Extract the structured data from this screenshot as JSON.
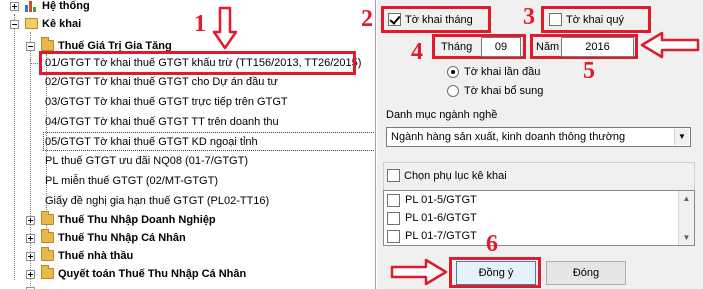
{
  "tree": {
    "items": [
      {
        "label": "Hệ thống",
        "bold": true
      },
      {
        "label": "Kê khai",
        "bold": true
      },
      {
        "label": "Thuế Giá Trị Gia Tăng",
        "bold": true
      },
      {
        "label": "01/GTGT Tờ khai thuế GTGT khấu trừ (TT156/2013, TT26/2015)",
        "bold": false
      },
      {
        "label": "02/GTGT Tờ khai thuế GTGT cho Dự án đầu tư",
        "bold": false
      },
      {
        "label": "03/GTGT Tờ khai thuế GTGT trực tiếp trên GTGT",
        "bold": false
      },
      {
        "label": "04/GTGT Tờ khai thuế GTGT TT trên doanh thu",
        "bold": false
      },
      {
        "label": "05/GTGT Tờ khai thuế GTGT KD ngoại tỉnh",
        "bold": false
      },
      {
        "label": "PL thuế GTGT ưu đãi NQ08 (01-7/GTGT)",
        "bold": false
      },
      {
        "label": "PL miễn thuế GTGT (02/MT-GTGT)",
        "bold": false
      },
      {
        "label": "Giấy đề nghị gia hạn thuế GTGT (PL02-TT16)",
        "bold": false
      },
      {
        "label": "Thuế Thu Nhập Doanh Nghiệp",
        "bold": true
      },
      {
        "label": "Thuế Thu Nhập Cá Nhân",
        "bold": true
      },
      {
        "label": "Thuế nhà thầu",
        "bold": true
      },
      {
        "label": "Quyết toán Thuế Thu Nhập Cá Nhân",
        "bold": true
      }
    ]
  },
  "panel": {
    "monthly_label": "Tờ khai tháng",
    "quarterly_label": "Tờ khai quý",
    "month_label": "Tháng",
    "month_value": "09",
    "year_label": "Năm",
    "year_value": "2016",
    "first_label": "Tờ khai lần đầu",
    "supplement_label": "Tờ khai bổ sung",
    "industry_label": "Danh mục ngành nghề",
    "industry_value": "Ngành hàng sản xuất, kinh doanh thông thường",
    "appendix_label": "Chọn phụ lục kê khai",
    "appendix_items": [
      "PL 01-5/GTGT",
      "PL 01-6/GTGT",
      "PL 01-7/GTGT"
    ],
    "ok_label": "Đồng ý",
    "close_label": "Đóng"
  },
  "annotations": [
    "1",
    "2",
    "3",
    "4",
    "5",
    "6"
  ],
  "colors": {
    "annotation": "#e01c2c",
    "panel_bg": "#f0f0f0"
  }
}
